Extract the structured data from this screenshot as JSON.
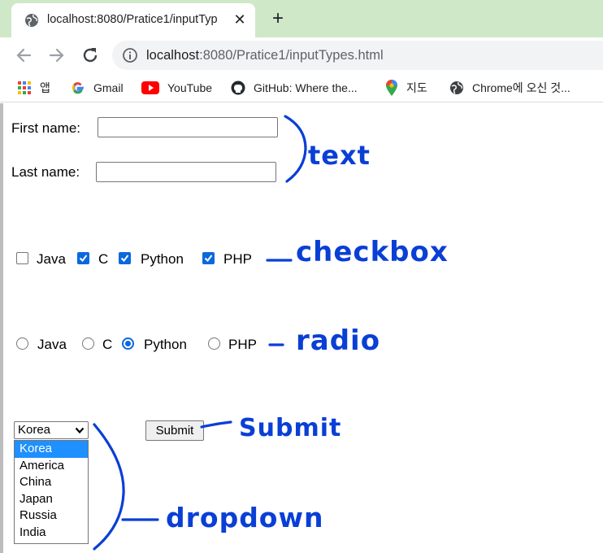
{
  "browser": {
    "tab_title": "localhost:8080/Pratice1/inputTyp",
    "url_host": "localhost",
    "url_path": ":8080/Pratice1/inputTypes.html",
    "bookmarks": [
      {
        "label": "앱",
        "icon": "apps-grid-icon"
      },
      {
        "label": "Gmail",
        "icon": "google-g-icon"
      },
      {
        "label": "YouTube",
        "icon": "youtube-icon"
      },
      {
        "label": "GitHub: Where the...",
        "icon": "github-icon"
      },
      {
        "label": "지도",
        "icon": "maps-pin-icon"
      },
      {
        "label": "Chrome에 오신 것...",
        "icon": "globe-icon"
      }
    ]
  },
  "form": {
    "first_name_label": "First name:",
    "first_name_value": "",
    "last_name_label": "Last name:",
    "last_name_value": "",
    "checkboxes": [
      {
        "label": "Java",
        "checked": false
      },
      {
        "label": "C",
        "checked": true
      },
      {
        "label": "Python",
        "checked": true
      },
      {
        "label": "PHP",
        "checked": true
      }
    ],
    "radios": [
      {
        "label": "Java",
        "checked": false
      },
      {
        "label": "C",
        "checked": false
      },
      {
        "label": "Python",
        "checked": true
      },
      {
        "label": "PHP",
        "checked": false
      }
    ],
    "select_value": "Korea",
    "select_options": [
      "Korea",
      "America",
      "China",
      "Japan",
      "Russia",
      "India"
    ],
    "submit_label": "Submit"
  },
  "annotations": {
    "text": "text",
    "checkbox": "checkbox",
    "radio": "radio",
    "submit": "Submit",
    "dropdown": "dropdown"
  },
  "colors": {
    "accent": "#0b68dd",
    "ink": "#0a3fd6",
    "tabstrip": "#cfe8c8"
  }
}
